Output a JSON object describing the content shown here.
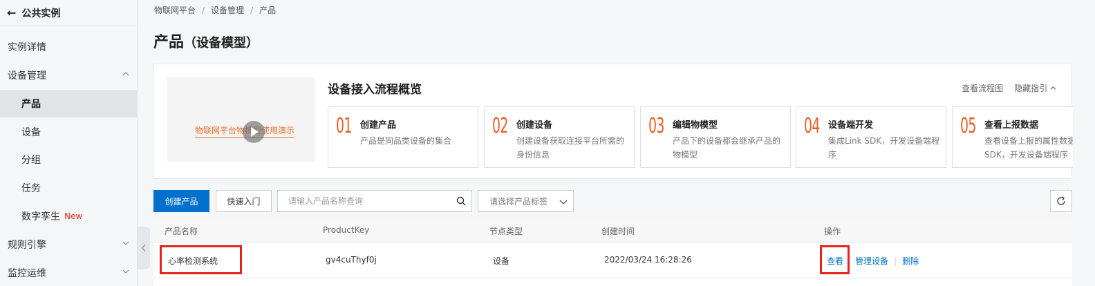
{
  "sidebar": {
    "back_label": "公共实例",
    "items": [
      {
        "label": "实例详情"
      },
      {
        "label": "设备管理"
      },
      {
        "label": "产品"
      },
      {
        "label": "设备"
      },
      {
        "label": "分组"
      },
      {
        "label": "任务"
      },
      {
        "label": "数字孪生",
        "badge": "New"
      },
      {
        "label": "规则引擎"
      },
      {
        "label": "监控运维"
      }
    ]
  },
  "breadcrumb": [
    "物联网平台",
    "设备管理",
    "产品"
  ],
  "page": {
    "title": "产品",
    "subtitle": "（设备模型）"
  },
  "guide": {
    "video_caption": "物联网平台物模型使用演示",
    "title": "设备接入流程概览",
    "link_flowchart": "查看流程图",
    "link_hide": "隐藏指引",
    "steps": [
      {
        "num": "01",
        "title": "创建产品",
        "desc": "产品是同品类设备的集合"
      },
      {
        "num": "02",
        "title": "创建设备",
        "desc": "创建设备获取连接平台所需的身份信息"
      },
      {
        "num": "03",
        "title": "编辑物模型",
        "desc": "产品下的设备都会继承产品的物模型"
      },
      {
        "num": "04",
        "title": "设备端开发",
        "desc": "集成Link SDK，开发设备端程序"
      },
      {
        "num": "05",
        "title": "查看上报数据",
        "desc": "查看设备上报的属性数据SDK，开发设备端程序"
      }
    ]
  },
  "toolbar": {
    "create_label": "创建产品",
    "quickstart_label": "快速入门",
    "search_placeholder": "请输入产品名称查询",
    "tag_select_placeholder": "请选择产品标签"
  },
  "table": {
    "headers": [
      "产品名称",
      "ProductKey",
      "节点类型",
      "创建时间",
      "操作"
    ],
    "rows": [
      {
        "name": "心率检测系统",
        "product_key": "gv4cuThyf0j",
        "node_type": "设备",
        "created": "2022/03/24 16:28:26",
        "actions": [
          "查看",
          "管理设备",
          "删除"
        ]
      }
    ]
  },
  "colors": {
    "primary": "#0070cc",
    "step_number": "#ef5b25",
    "highlight": "#e5211a",
    "new_badge": "#e5261c"
  }
}
